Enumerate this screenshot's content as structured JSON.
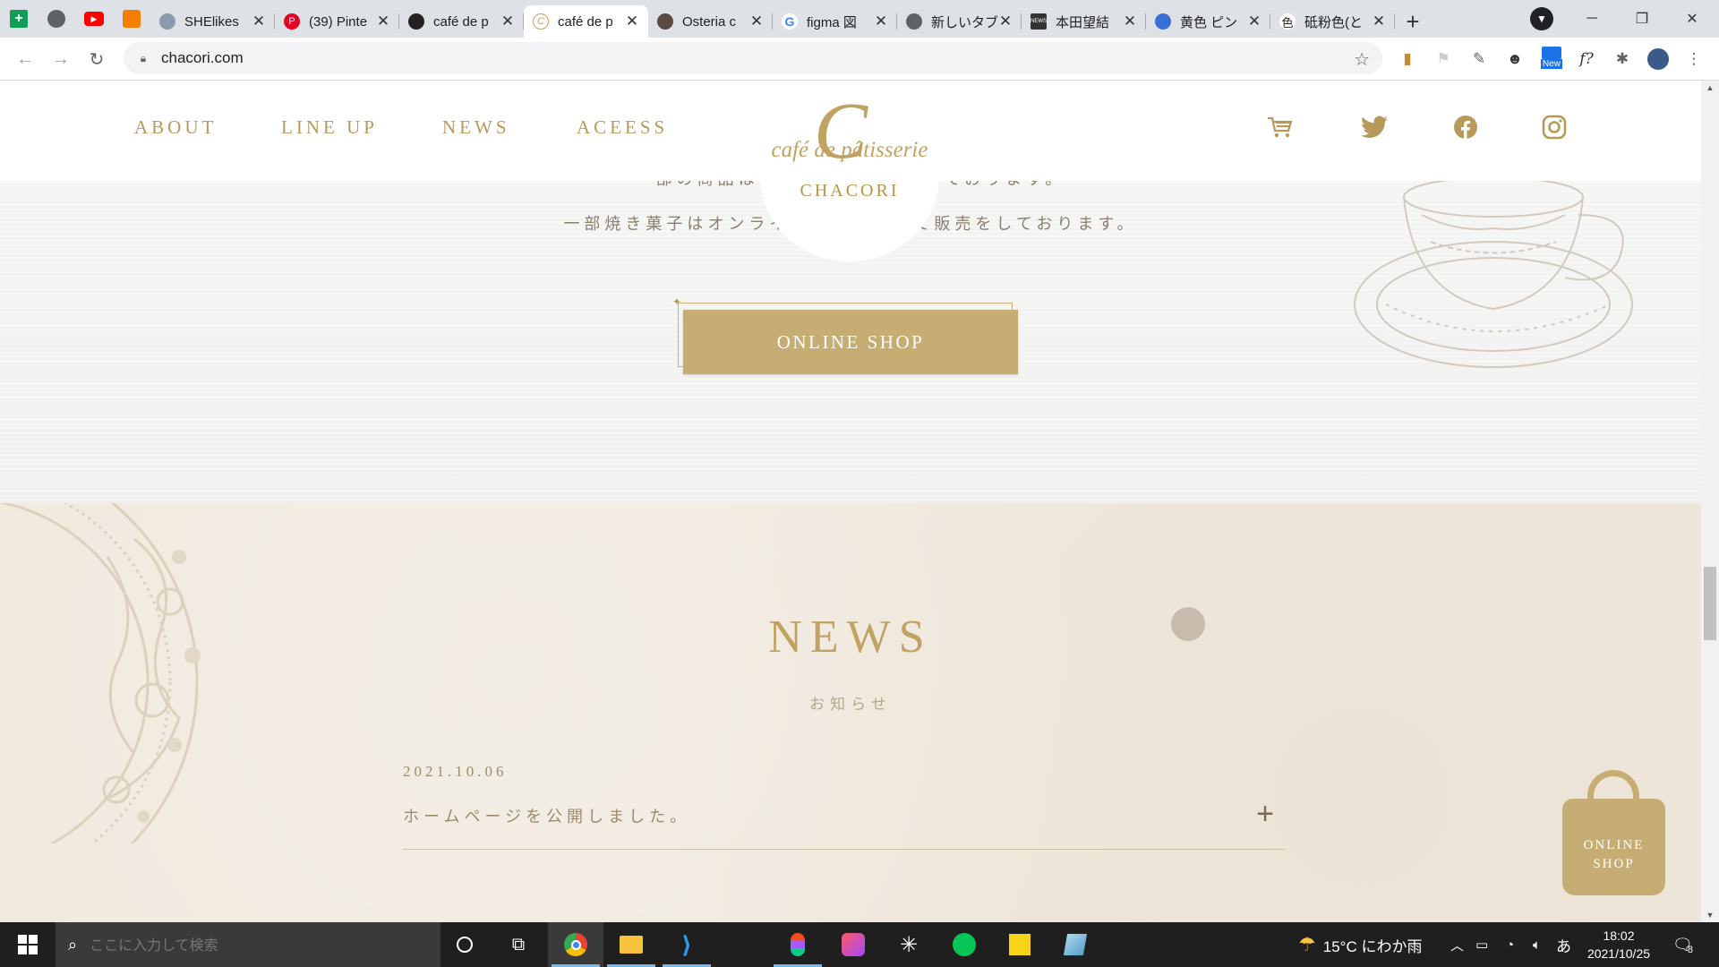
{
  "browser": {
    "tabs": [
      {
        "title": "SHElikes",
        "favicon_color": "#8a9bb0"
      },
      {
        "title": "(39) Pinte",
        "favicon_color": "#e60023"
      },
      {
        "title": "café de p",
        "favicon_color": "#222222"
      },
      {
        "title": "café de p",
        "favicon_color": "#c0a262",
        "active": true
      },
      {
        "title": "Osteria c",
        "favicon_color": "#5a4a42"
      },
      {
        "title": "figma 図",
        "favicon_color": "#4285f4"
      },
      {
        "title": "新しいタブ",
        "favicon_color": "#5f6368"
      },
      {
        "title": "本田望結",
        "favicon_color": "#333333"
      },
      {
        "title": "黄色 ピン",
        "favicon_color": "#3b6fd8"
      },
      {
        "title": "砥粉色(と",
        "favicon_color": "#222222"
      }
    ],
    "url": "chacori.com",
    "ext_new_label": "New"
  },
  "site": {
    "nav": [
      "ABOUT",
      "LINE UP",
      "NEWS",
      "ACEESS"
    ],
    "logo": {
      "initial": "C",
      "script": "café de pâtisserie",
      "brand": "CHACORI"
    },
    "upper_text_1": "一部の商品は　　　　　　　　　ております。",
    "upper_text_2": "一部焼き菓子はオンライン　　　　にて販売をしております。",
    "cta_label": "ONLINE SHOP",
    "news": {
      "title": "NEWS",
      "subtitle": "お知らせ",
      "items": [
        {
          "date": "2021.10.06",
          "text": "ホームページを公開しました。"
        }
      ]
    },
    "bag_label_1": "ONLINE",
    "bag_label_2": "SHOP"
  },
  "taskbar": {
    "search_placeholder": "ここに入力して検索",
    "weather": "15°C にわか雨",
    "ime": "あ",
    "time": "18:02",
    "date": "2021/10/25",
    "notification_count": "8"
  },
  "colors": {
    "gold": "#c6ad73",
    "beige": "#efe8dc"
  }
}
